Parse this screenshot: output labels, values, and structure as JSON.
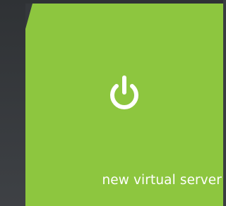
{
  "tile": {
    "label": "new virtual server",
    "icon": "power-icon",
    "background_color": "#8dc63f",
    "text_color": "#ffffff"
  }
}
